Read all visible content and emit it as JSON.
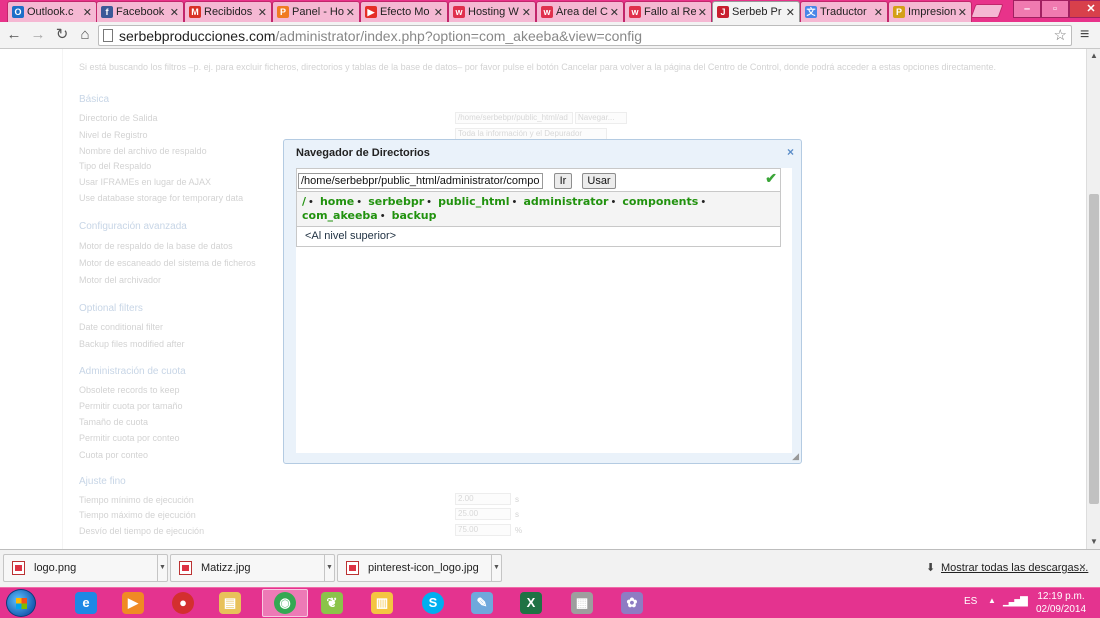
{
  "browser": {
    "tabs": [
      {
        "label": "Outlook.c",
        "icon": "outlook-icon",
        "color": "#1e6fc8",
        "glyph": "O"
      },
      {
        "label": "Facebook",
        "icon": "facebook-icon",
        "color": "#3b5998",
        "glyph": "f"
      },
      {
        "label": "Recibidos",
        "icon": "gmail-icon",
        "color": "#d93025",
        "glyph": "M"
      },
      {
        "label": "Panel - Ho",
        "icon": "panel-icon",
        "color": "#f07b22",
        "glyph": "P"
      },
      {
        "label": "Efecto Mo",
        "icon": "youtube-icon",
        "color": "#e52d27",
        "glyph": "▶"
      },
      {
        "label": "Hosting W",
        "icon": "hosting-icon",
        "color": "#e0304c",
        "glyph": "w"
      },
      {
        "label": "Área del C",
        "icon": "hosting-icon",
        "color": "#e0304c",
        "glyph": "w"
      },
      {
        "label": "Fallo al Re",
        "icon": "hosting-icon",
        "color": "#e0304c",
        "glyph": "w"
      },
      {
        "label": "Serbeb Pr",
        "icon": "joomla-icon",
        "color": "#c8202f",
        "glyph": "J"
      },
      {
        "label": "Traductor",
        "icon": "translate-icon",
        "color": "#4a86e8",
        "glyph": "文"
      },
      {
        "label": "Impresion",
        "icon": "pinterest-icon",
        "color": "#d4a017",
        "glyph": "P"
      }
    ],
    "address": {
      "host": "serbebproducciones.com",
      "path": "/administrator/index.php?option=com_akeeba&view=config"
    }
  },
  "background": {
    "intro": "Si está buscando los filtros –p. ej. para excluir ficheros, directorios y tablas de la base de datos– por favor pulse el botón Cancelar para volver a la página del Centro de Control, donde podrá acceder a estas opciones directamente.",
    "sections": {
      "basic": "Básica",
      "advanced": "Configuración avanzada",
      "optional": "Optional filters",
      "quota": "Administración de cuota",
      "tuning": "Ajuste fino"
    },
    "labels": {
      "output_dir": "Directorio de Salida",
      "log_level": "Nivel de Registro",
      "archive_name": "Nombre del archivo de respaldo",
      "backup_type": "Tipo del Respaldo",
      "iframes": "Usar IFRAMEs en lugar de AJAX",
      "db_storage": "Use database storage for temporary data",
      "db_engine": "Motor de respaldo de la base de datos",
      "fs_engine": "Motor de escaneado del sistema de ficheros",
      "archiver": "Motor del archivador",
      "date_filter": "Date conditional filter",
      "modified_after": "Backup files modified after",
      "obsolete": "Obsolete records to keep",
      "quota_size": "Permitir cuota por tamaño",
      "size": "Tamaño de cuota",
      "quota_count": "Permitir cuota por conteo",
      "count": "Cuota por conteo",
      "min_time": "Tiempo mínimo de ejecución",
      "max_time": "Tiempo máximo de ejecución",
      "bias": "Desvío del tiempo de ejecución"
    },
    "fields": {
      "output_dir_value": "/home/serbebpr/public_html/ad",
      "browse_button": "Navegar...",
      "log_level_value": "Toda la información y el Depurador",
      "min_time_value": "2.00",
      "max_time_value": "25.00",
      "bias_value": "75.00",
      "unit_s": "s",
      "unit_pct": "%"
    }
  },
  "dialog": {
    "title": "Navegador de Directorios",
    "close": "×",
    "path_value": "/home/serbebpr/public_html/administrator/components/com_akeeba/backup",
    "go_label": "Ir",
    "use_label": "Usar",
    "breadcrumbs": [
      "/",
      "home",
      "serbebpr",
      "public_html",
      "administrator",
      "components",
      "com_akeeba",
      "backup"
    ],
    "up_level": "<Al nivel superior>"
  },
  "downloads": {
    "items": [
      "logo.png",
      "Matizz.jpg",
      "pinterest-icon_logo.jpg"
    ],
    "show_all": "Mostrar todas las descargas...",
    "close": "×"
  },
  "taskbar": {
    "apps": [
      {
        "name": "taskbar-internet-explorer",
        "icon": "internet-explorer-icon",
        "color": "#1e88e5",
        "glyph": "e"
      },
      {
        "name": "taskbar-media-player",
        "icon": "media-player-icon",
        "color": "#f08a24",
        "glyph": "▶"
      },
      {
        "name": "taskbar-app-ninja",
        "icon": "ninja-icon",
        "color": "#d32f2f",
        "glyph": "●"
      },
      {
        "name": "taskbar-file-explorer",
        "icon": "folder-icon",
        "color": "#e8c15a",
        "glyph": "▤"
      },
      {
        "name": "taskbar-chrome",
        "icon": "chrome-icon",
        "color": "#34a853",
        "glyph": "◉"
      },
      {
        "name": "taskbar-green-app",
        "icon": "leaf-icon",
        "color": "#8bc34a",
        "glyph": "❦"
      },
      {
        "name": "taskbar-folders",
        "icon": "folders-icon",
        "color": "#f4c542",
        "glyph": "▥"
      },
      {
        "name": "taskbar-skype",
        "icon": "skype-icon",
        "color": "#00aff0",
        "glyph": "S"
      },
      {
        "name": "taskbar-notes",
        "icon": "notes-icon",
        "color": "#6fa8dc",
        "glyph": "✎"
      },
      {
        "name": "taskbar-excel",
        "icon": "excel-icon",
        "color": "#1f7244",
        "glyph": "X"
      },
      {
        "name": "taskbar-calculator",
        "icon": "calculator-icon",
        "color": "#9e9e9e",
        "glyph": "▦"
      },
      {
        "name": "taskbar-paint",
        "icon": "paint-icon",
        "color": "#8e7cc3",
        "glyph": "✿"
      }
    ],
    "language": "ES",
    "time": "12:19 p.m.",
    "date": "02/09/2014"
  }
}
